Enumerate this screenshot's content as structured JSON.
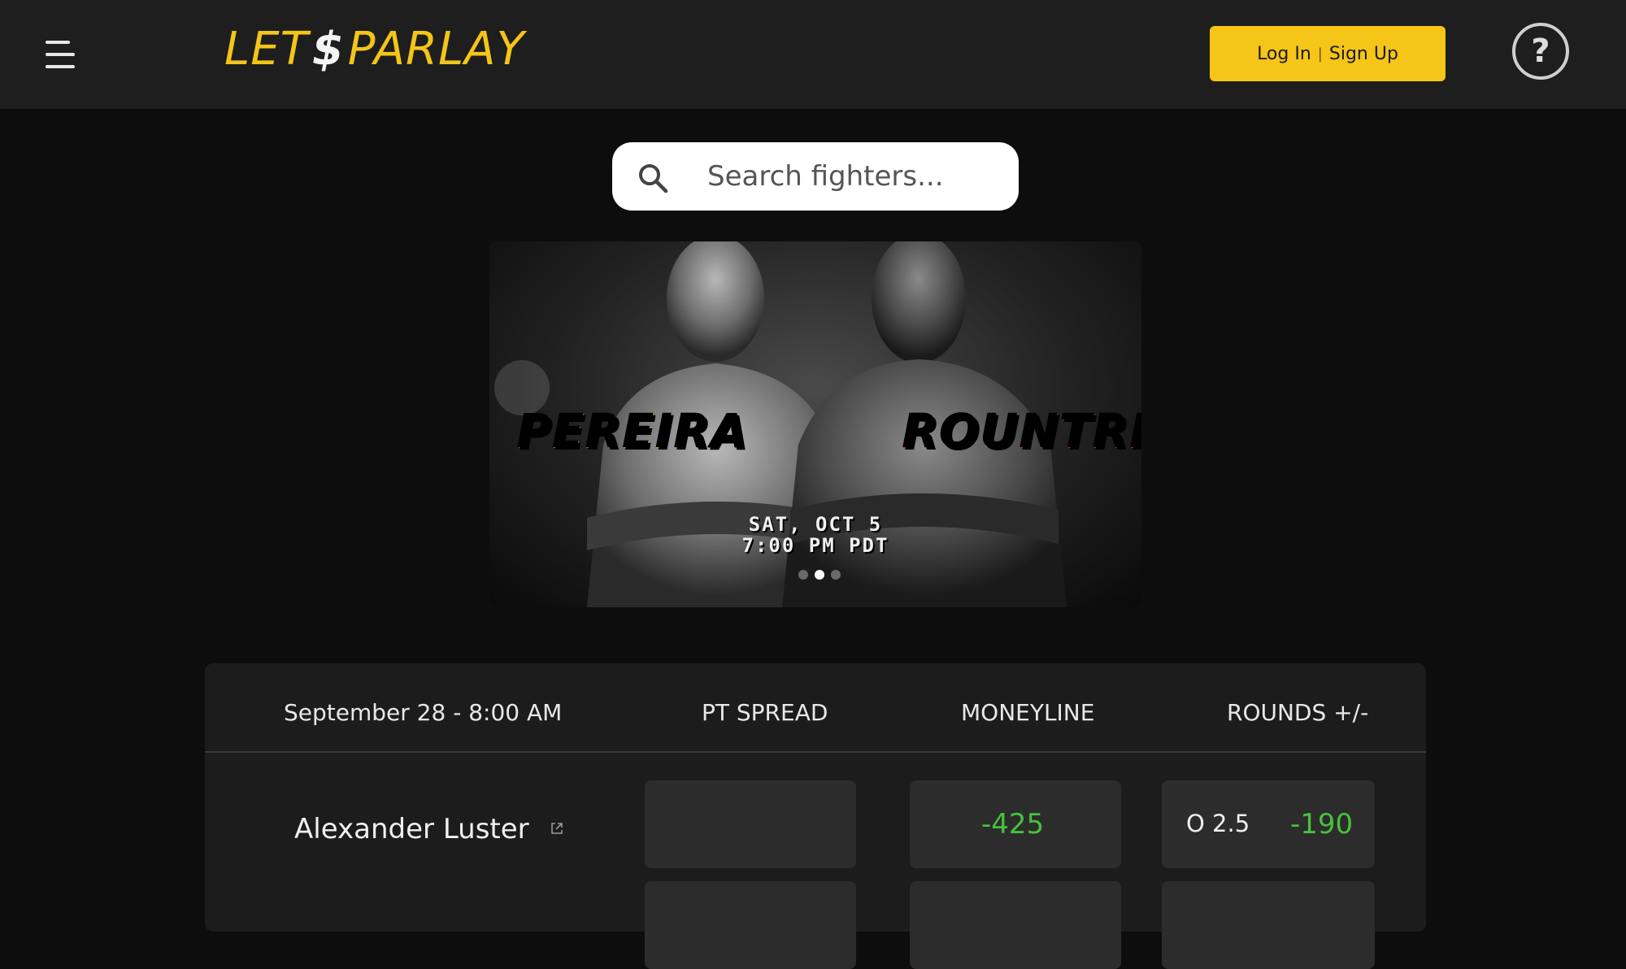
{
  "header": {
    "logo_left": "LET",
    "logo_symbol": "$",
    "logo_right": "PARLAY",
    "login_label": "Log In",
    "separator": "|",
    "signup_label": "Sign Up",
    "help_symbol": "?"
  },
  "search": {
    "placeholder": "Search fighters..."
  },
  "banner": {
    "fighter_left": "PEREIRA",
    "fighter_right": "ROUNTREE",
    "date_line1": "SAT, OCT 5",
    "date_line2": "7:00 PM PDT",
    "slides": 3,
    "active_slide": 2
  },
  "odds_table": {
    "date_header": "September 28 - 8:00 AM",
    "col_spread": "PT SPREAD",
    "col_moneyline": "MONEYLINE",
    "col_rounds": "ROUNDS +/-",
    "rows": [
      {
        "fighter": "Alexander Luster",
        "spread": "",
        "moneyline": "-425",
        "rounds_line": "O 2.5",
        "rounds_odds": "-190"
      }
    ]
  },
  "colors": {
    "accent": "#f5c518",
    "positive_odds": "#46c23c",
    "header_bg": "#1e1e1e",
    "page_bg": "#0d0d0d"
  },
  "icons": [
    "menu-icon",
    "help-icon",
    "search-icon",
    "external-link-icon"
  ]
}
